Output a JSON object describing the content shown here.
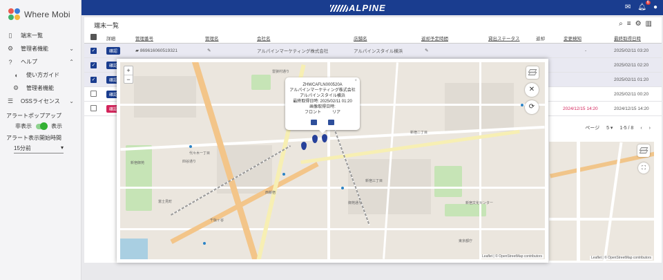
{
  "app": {
    "logo_text": "Where Mobi",
    "brand": "ALPINE"
  },
  "header": {
    "notification_count": "6"
  },
  "sidebar": {
    "items": [
      {
        "label": "端末一覧",
        "icon": "phone-icon"
      },
      {
        "label": "管理者機能",
        "icon": "gear-icon",
        "caret": "chevron-down-icon"
      },
      {
        "label": "ヘルプ",
        "icon": "help-icon",
        "caret": "chevron-up-icon"
      },
      {
        "label": "使い方ガイド",
        "icon": "mouse-icon"
      },
      {
        "label": "管理者機能",
        "icon": "gear-icon"
      },
      {
        "label": "OSSライセンス",
        "icon": "list-icon",
        "caret": "chevron-down-icon"
      }
    ],
    "alert_popup_label": "アラートポップアップ",
    "toggle_off_label": "非表示",
    "toggle_on_label": "表示",
    "alert_start_label": "アラート表示開始時間",
    "alert_start_value": "15分前"
  },
  "page": {
    "title": "端末一覧"
  },
  "table": {
    "headers": [
      "詳細",
      "管理番号",
      "管理名",
      "会社名",
      "店舗名",
      "返却予定時間",
      "貸出ステータス",
      "返却",
      "変更検知",
      "最終取得日時"
    ],
    "rows": [
      {
        "checked": true,
        "status": "確認",
        "status_color": "blue",
        "id": "869616060519321",
        "company": "アルパインマーケティング株式会社",
        "store": "アルパインスタイル横浜",
        "last": "2025/02/11 03:20",
        "detect": "-"
      },
      {
        "checked": true,
        "status": "確認",
        "status_color": "blue",
        "id": "",
        "company": "",
        "store": "",
        "last": "2025/02/11 02:20",
        "detect": ""
      },
      {
        "checked": true,
        "status": "確認",
        "status_color": "blue",
        "id": "",
        "company": "",
        "store": "",
        "last": "2025/02/11 01:20",
        "detect": ""
      },
      {
        "checked": false,
        "status": "確認",
        "status_color": "blue",
        "id": "",
        "company": "",
        "store": "",
        "last": "2025/02/11 00:20",
        "detect": ""
      },
      {
        "checked": false,
        "status": "確認",
        "status_color": "red",
        "id": "",
        "company": "",
        "store": "",
        "last": "2024/12/15 14:20",
        "detect": "2024/12/15 14:20"
      }
    ],
    "pager": {
      "per_page_label": "ページ",
      "per_page": "5",
      "range": "1-5 / 8"
    }
  },
  "map_popup": {
    "line1": "ZHWCAFLN000520A",
    "line2": "アルパインマーケティング株式会社",
    "line3": "アルパインスタイル横浜",
    "line4": "最終取得日時: 2025/02/11 01:20",
    "line5": "画像取得日時:",
    "front_label": "フロント",
    "rear_label": "リア"
  },
  "map": {
    "attribution": "Leaflet | © OpenStreetMap contributors",
    "labels": [
      "雷狭村通り",
      "新宿二丁目",
      "新宿三丁目",
      "代々木一丁目",
      "千駄ヶ谷",
      "四谷通り",
      "富士見町",
      "新宿御苑",
      "西新宿",
      "御苑通り",
      "東京都庁",
      "新宿文化センター"
    ]
  },
  "colors": {
    "brand": "#1a3d8f",
    "accent_red": "#d3245b",
    "toggle_green": "#33b033"
  }
}
